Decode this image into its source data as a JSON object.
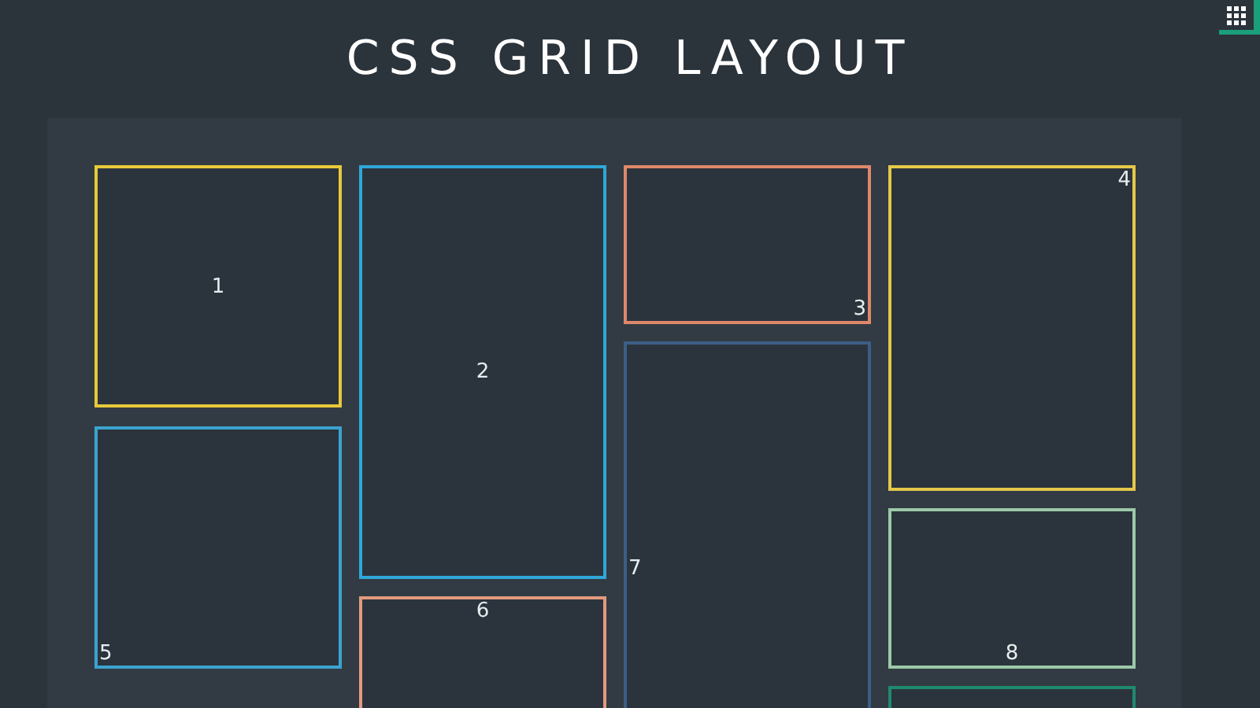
{
  "title": "CSS GRID LAYOUT",
  "grid_items": [
    {
      "label": "1",
      "color": "#e8c93a"
    },
    {
      "label": "2",
      "color": "#2fa7d8"
    },
    {
      "label": "3",
      "color": "#e0876a"
    },
    {
      "label": "4",
      "color": "#e5c84a"
    },
    {
      "label": "5",
      "color": "#3aa4d0"
    },
    {
      "label": "6",
      "color": "#e39a7e"
    },
    {
      "label": "7",
      "color": "#3b5f86"
    },
    {
      "label": "8",
      "color": "#9cc9a8"
    },
    {
      "color": "#1f8a6e"
    }
  ]
}
